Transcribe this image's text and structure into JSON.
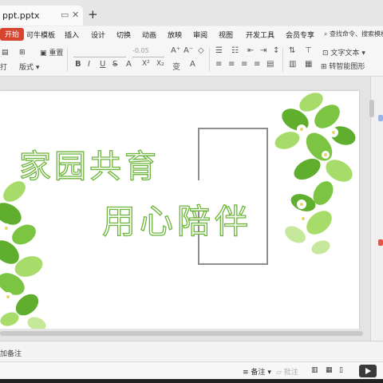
{
  "document": {
    "file_name": "ppt.pptx"
  },
  "menu": {
    "items": [
      "开始",
      "可牛模板",
      "插入",
      "设计",
      "切换",
      "动画",
      "放映",
      "审阅",
      "视图",
      "开发工具",
      "会员专享"
    ],
    "active_index": 0,
    "search_text": "查找命令、搜索模板"
  },
  "toolbar": {
    "reset_label": "重置",
    "font_size_value": "-0.05",
    "layout_label": "版式",
    "left_cut_label": "打",
    "textbox_label": "文字文本",
    "shape_label": "转智能图形",
    "format_buttons": [
      "B",
      "I",
      "U",
      "S",
      "A",
      "X²",
      "X₂"
    ],
    "para_label": "变",
    "highlight_label": "A"
  },
  "slide": {
    "title_line1": "家园共育",
    "title_line2": "用心陪伴"
  },
  "notes": {
    "placeholder": "加备注"
  },
  "status": {
    "notes_toggle": "备注",
    "comment_toggle": "批注"
  },
  "colors": {
    "accent": "#d9442e",
    "title_outline": "#6cb53a",
    "frame": "#8e8e8e",
    "leaf_dark": "#5fae2e",
    "leaf_light": "#a8dc6a"
  }
}
